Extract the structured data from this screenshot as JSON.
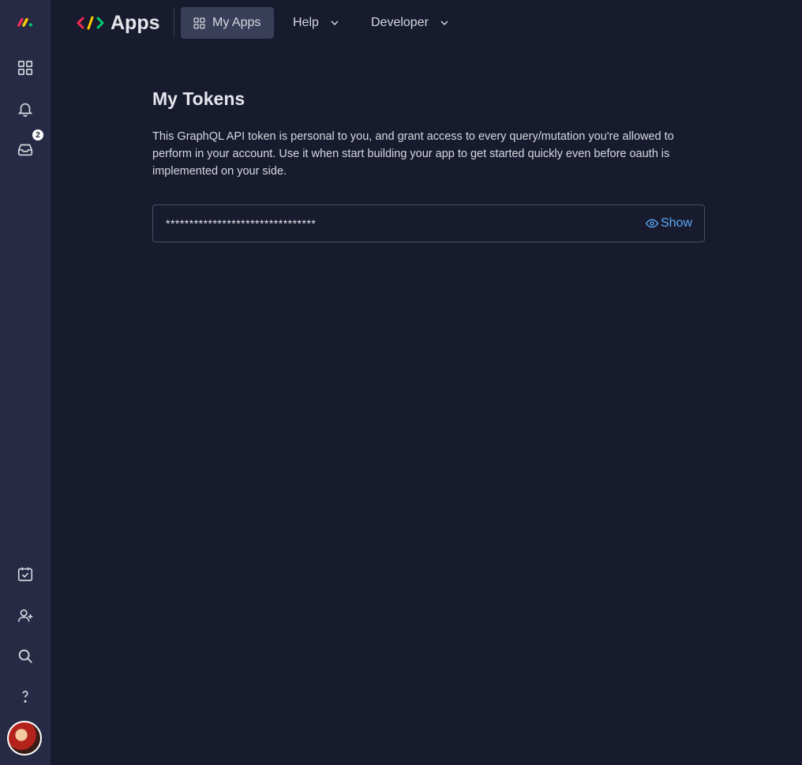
{
  "sidebar": {
    "notifications_badge": "2",
    "icons": [
      "monday-logo-icon",
      "workspaces-grid-icon",
      "bell-icon",
      "inbox-icon",
      "calendar-check-icon",
      "invite-user-icon",
      "search-icon",
      "help-icon",
      "avatar"
    ]
  },
  "header": {
    "app_title": "Apps",
    "nav": {
      "my_apps": "My Apps",
      "help": "Help",
      "developer": "Developer"
    }
  },
  "main": {
    "title": "My Tokens",
    "description": "This GraphQL API token is personal to you, and grant access to every query/mutation you're allowed to perform in your account. Use it when start building your app to get started quickly even before oauth is implemented on your side.",
    "token_masked": "********************************",
    "show_label": "Show"
  },
  "colors": {
    "background": "#181b2e",
    "sidebar": "#262a44",
    "accent_link": "#5aa9f5",
    "active_nav": "#3a3f59"
  }
}
